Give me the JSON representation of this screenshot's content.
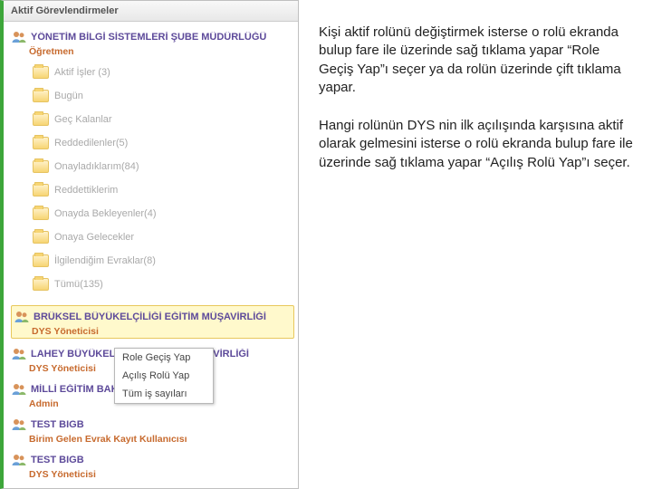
{
  "panel": {
    "title": "Aktif Görevlendirmeler"
  },
  "roles": [
    {
      "title": "YÖNETİM BİLGİ SİSTEMLERİ ŞUBE MÜDÜRLÜĞÜ",
      "sub": "Öğretmen",
      "selected": false,
      "folders": [
        "Aktif İşler (3)",
        "Bugün",
        "Geç Kalanlar",
        "Reddedilenler(5)",
        "Onayladıklarım(84)",
        "Reddettiklerim",
        "Onayda Bekleyenler(4)",
        "Onaya Gelecekler",
        "İlgilendiğim Evraklar(8)",
        "Tümü(135)"
      ]
    },
    {
      "title": "BRÜKSEL BÜYÜKELÇİLİĞİ EĞİTİM MÜŞAVİRLİĞİ",
      "sub": "DYS Yöneticisi",
      "selected": true,
      "folders": []
    },
    {
      "title": "LAHEY BÜYÜKELÇİLİĞİ EĞİTİM MÜŞAVİRLİĞİ",
      "sub": "DYS Yöneticisi",
      "selected": false,
      "folders": []
    },
    {
      "title": "MİLLİ EĞİTİM BAKANLIĞI",
      "sub": "Admin",
      "selected": false,
      "folders": []
    },
    {
      "title": "TEST BIGB",
      "sub": "Birim Gelen Evrak Kayıt Kullanıcısı",
      "selected": false,
      "folders": []
    },
    {
      "title": "TEST BIGB",
      "sub": "DYS Yöneticisi",
      "selected": false,
      "folders": []
    }
  ],
  "contextMenu": {
    "items": [
      "Role Geçiş Yap",
      "Açılış Rolü Yap",
      "Tüm iş sayıları"
    ]
  },
  "explain": {
    "p1": "Kişi aktif rolünü değiştirmek isterse o rolü ekranda bulup fare ile üzerinde sağ tıklama yapar “Role Geçiş Yap”ı seçer ya da rolün üzerinde çift tıklama yapar.",
    "p2": "Hangi rolünün DYS nin ilk açılışında karşısına aktif olarak gelmesini isterse o rolü ekranda bulup fare ile üzerinde sağ tıklama yapar “Açılış Rolü Yap”ı seçer."
  }
}
